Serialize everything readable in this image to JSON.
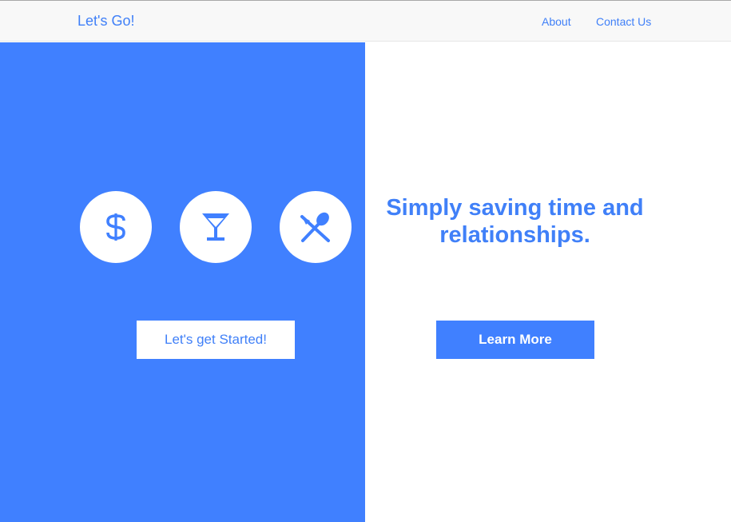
{
  "navbar": {
    "brand": "Let's Go!",
    "links": [
      {
        "label": "About"
      },
      {
        "label": "Contact Us"
      }
    ]
  },
  "hero": {
    "icons": [
      "dollar-icon",
      "cocktail-glass-icon",
      "utensils-icon"
    ],
    "start_button_label": "Let's get Started!",
    "headline": "Simply saving time and relationships.",
    "learn_more_label": "Learn More"
  },
  "colors": {
    "accent": "#4080ff",
    "accent_text": "#4080f8",
    "navbar_bg": "#f8f8f8",
    "white": "#ffffff"
  }
}
